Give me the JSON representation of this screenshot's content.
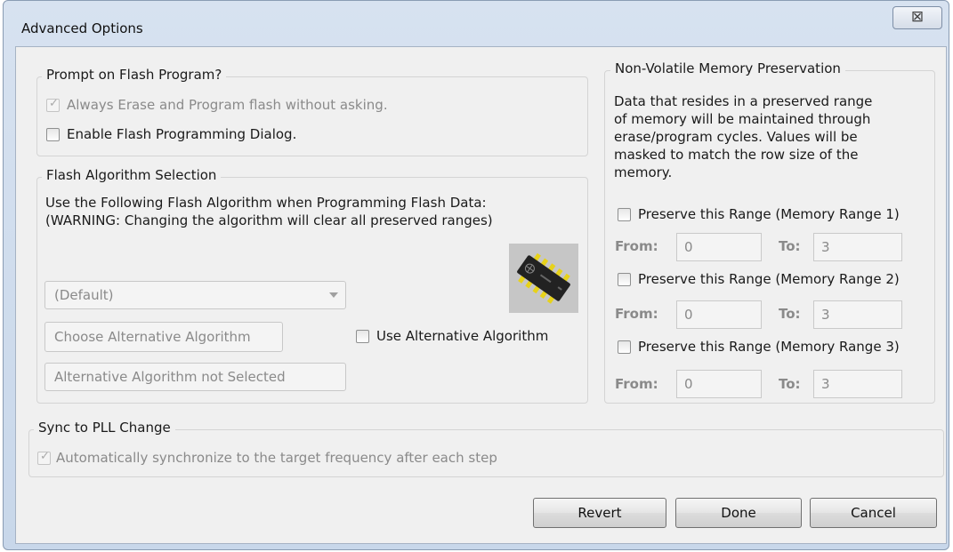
{
  "window": {
    "title": "Advanced Options",
    "close_glyph": "⊠"
  },
  "prompt_group": {
    "title": "Prompt on Flash Program?",
    "always_erase": {
      "label": "Always Erase and Program flash without asking.",
      "checked": true,
      "enabled": false
    },
    "enable_dialog": {
      "label": "Enable Flash Programming Dialog.",
      "checked": false,
      "enabled": true
    }
  },
  "algo_group": {
    "title": "Flash Algorithm Selection",
    "description_line1": "Use the Following Flash Algorithm when Programming Flash Data:",
    "description_line2": "(WARNING: Changing the algorithm will clear all preserved ranges)",
    "algorithm_select": {
      "value": "(Default)"
    },
    "choose_button": "Choose Alternative Algorithm",
    "use_alternative": {
      "label": "Use Alternative Algorithm",
      "checked": false
    },
    "alternative_status": "Alternative Algorithm not Selected",
    "chip_icon": "ic-chip-icon"
  },
  "nvm_group": {
    "title": "Non-Volatile Memory Preservation",
    "description": [
      "Data that resides in a preserved range",
      "of memory will be maintained through",
      "erase/program cycles. Values will be",
      "masked to match the row size of the",
      "memory."
    ],
    "from_label": "From:",
    "to_label": "To:",
    "ranges": [
      {
        "label": "Preserve this Range (Memory Range 1)",
        "checked": false,
        "from": "0",
        "to": "3"
      },
      {
        "label": "Preserve this Range (Memory Range 2)",
        "checked": false,
        "from": "0",
        "to": "3"
      },
      {
        "label": "Preserve this Range (Memory Range 3)",
        "checked": false,
        "from": "0",
        "to": "3"
      }
    ]
  },
  "pll_group": {
    "title": "Sync to PLL Change",
    "auto_sync": {
      "label": "Automatically synchronize to the target frequency after each step",
      "checked": true,
      "enabled": false
    }
  },
  "buttons": {
    "revert": "Revert",
    "done": "Done",
    "cancel": "Cancel"
  }
}
